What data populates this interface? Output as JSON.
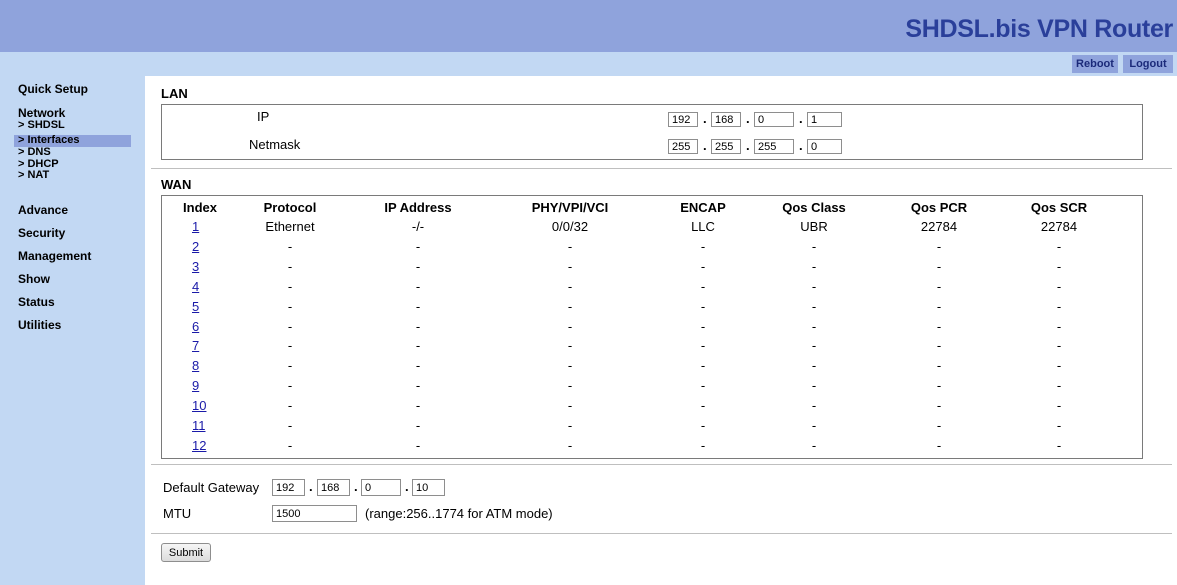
{
  "header": {
    "title": "SHDSL.bis VPN Router",
    "reboot_label": "Reboot",
    "logout_label": "Logout"
  },
  "sidebar": {
    "quick_setup": "Quick Setup",
    "network": "Network",
    "network_items": [
      "> SHDSL",
      "> Interfaces",
      "> DNS",
      "> DHCP",
      "> NAT"
    ],
    "active_item": "> Interfaces",
    "advance": "Advance",
    "security": "Security",
    "management": "Management",
    "show": "Show",
    "status": "Status",
    "utilities": "Utilities"
  },
  "lan": {
    "title": "LAN",
    "ip_label": "IP",
    "ip": [
      "192",
      "168",
      "0",
      "1"
    ],
    "netmask_label": "Netmask",
    "netmask": [
      "255",
      "255",
      "255",
      "0"
    ]
  },
  "wan": {
    "title": "WAN",
    "columns": [
      "Index",
      "Protocol",
      "IP Address",
      "PHY/VPI/VCI",
      "ENCAP",
      "Qos Class",
      "Qos PCR",
      "Qos SCR"
    ],
    "rows": [
      {
        "index": "1",
        "protocol": "Ethernet",
        "ip": "-/-",
        "phy": "0/0/32",
        "encap": "LLC",
        "qos_class": "UBR",
        "pcr": "22784",
        "scr": "22784"
      },
      {
        "index": "2",
        "protocol": "-",
        "ip": "-",
        "phy": "-",
        "encap": "-",
        "qos_class": "-",
        "pcr": "-",
        "scr": "-"
      },
      {
        "index": "3",
        "protocol": "-",
        "ip": "-",
        "phy": "-",
        "encap": "-",
        "qos_class": "-",
        "pcr": "-",
        "scr": "-"
      },
      {
        "index": "4",
        "protocol": "-",
        "ip": "-",
        "phy": "-",
        "encap": "-",
        "qos_class": "-",
        "pcr": "-",
        "scr": "-"
      },
      {
        "index": "5",
        "protocol": "-",
        "ip": "-",
        "phy": "-",
        "encap": "-",
        "qos_class": "-",
        "pcr": "-",
        "scr": "-"
      },
      {
        "index": "6",
        "protocol": "-",
        "ip": "-",
        "phy": "-",
        "encap": "-",
        "qos_class": "-",
        "pcr": "-",
        "scr": "-"
      },
      {
        "index": "7",
        "protocol": "-",
        "ip": "-",
        "phy": "-",
        "encap": "-",
        "qos_class": "-",
        "pcr": "-",
        "scr": "-"
      },
      {
        "index": "8",
        "protocol": "-",
        "ip": "-",
        "phy": "-",
        "encap": "-",
        "qos_class": "-",
        "pcr": "-",
        "scr": "-"
      },
      {
        "index": "9",
        "protocol": "-",
        "ip": "-",
        "phy": "-",
        "encap": "-",
        "qos_class": "-",
        "pcr": "-",
        "scr": "-"
      },
      {
        "index": "10",
        "protocol": "-",
        "ip": "-",
        "phy": "-",
        "encap": "-",
        "qos_class": "-",
        "pcr": "-",
        "scr": "-"
      },
      {
        "index": "11",
        "protocol": "-",
        "ip": "-",
        "phy": "-",
        "encap": "-",
        "qos_class": "-",
        "pcr": "-",
        "scr": "-"
      },
      {
        "index": "12",
        "protocol": "-",
        "ip": "-",
        "phy": "-",
        "encap": "-",
        "qos_class": "-",
        "pcr": "-",
        "scr": "-"
      }
    ]
  },
  "gateway": {
    "label": "Default Gateway",
    "ip": [
      "192",
      "168",
      "0",
      "10"
    ]
  },
  "mtu": {
    "label": "MTU",
    "value": "1500",
    "hint": "(range:256..1774 for ATM mode)"
  },
  "submit_label": "Submit",
  "colors": {
    "header_bg": "#8fa3dc",
    "title_color": "#2a3f9a",
    "sidebar_bg": "#c2d8f3",
    "link_color": "#1a1aa8"
  }
}
